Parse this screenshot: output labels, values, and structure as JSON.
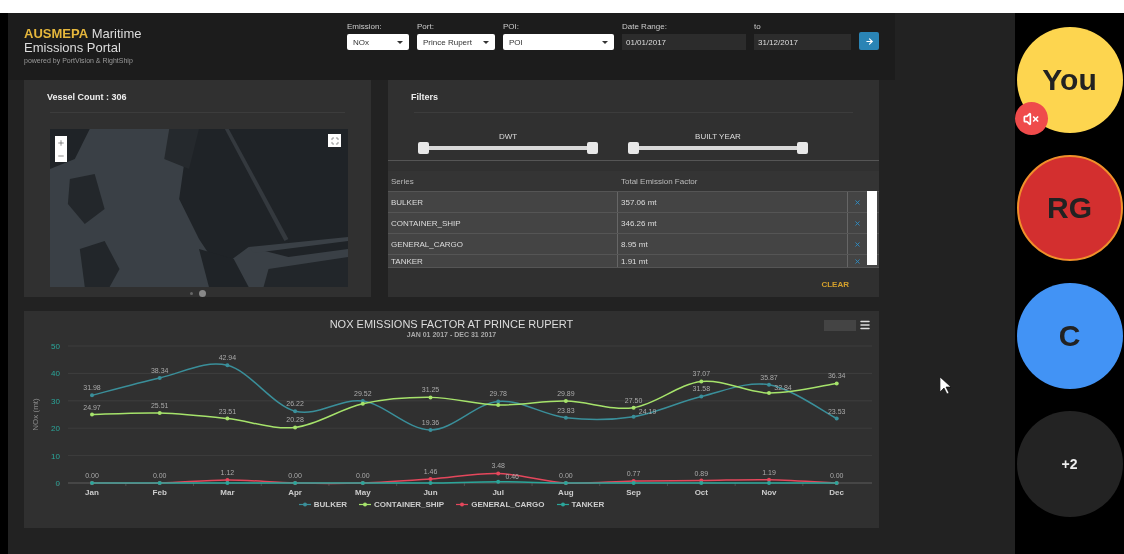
{
  "header": {
    "accent": "AUSMEPA",
    "title": "Maritime Emissions Portal",
    "tagline": "powered by PortVision & RightShip",
    "fields": [
      {
        "kind": "select",
        "label": "Emission:",
        "value": "NOx"
      },
      {
        "kind": "select",
        "label": "Port:",
        "value": "Prince Rupert"
      },
      {
        "kind": "select",
        "label": "POI:",
        "value": "POI"
      },
      {
        "kind": "date",
        "label": "Date Range:",
        "value": "01/01/2017"
      },
      {
        "kind": "date",
        "label": "to",
        "value": "31/12/2017"
      }
    ]
  },
  "map_panel": {
    "title": "Vessel Count : 306",
    "pager": [
      {
        "selected": false
      },
      {
        "selected": true
      }
    ]
  },
  "filters": {
    "title": "Filters",
    "sliders": [
      {
        "label": "DWT",
        "level": 1
      },
      {
        "label": "BUILT YEAR",
        "level": 1
      }
    ],
    "table": {
      "columns": [
        "Series",
        "Total Emission Factor"
      ],
      "rows": [
        {
          "series": "BULKER",
          "total": "357.06 mt"
        },
        {
          "series": "CONTAINER_SHIP",
          "total": "346.26 mt"
        },
        {
          "series": "GENERAL_CARGO",
          "total": "8.95 mt"
        },
        {
          "series": "TANKER",
          "total": "1.91 mt"
        }
      ]
    },
    "clear": "CLEAR"
  },
  "chart": {
    "subtitle": "JAN 01 2017 - DEC 31 2017",
    "chart_data": {
      "type": "line",
      "title": "NOX EMISSIONS FACTOR AT PRINCE RUPERT",
      "ylabel": "NOx (mt)",
      "categories": [
        "Jan",
        "Feb",
        "Mar",
        "Apr",
        "May",
        "Jun",
        "Jul",
        "Aug",
        "Sep",
        "Oct",
        "Nov",
        "Dec"
      ],
      "ylim": [
        0,
        50
      ],
      "yticks": [
        0,
        10,
        20,
        30,
        40,
        50
      ],
      "grid": true,
      "series": [
        {
          "name": "BULKER",
          "color": "#3a8f9a",
          "values": [
            31.98,
            38.34,
            42.94,
            26.22,
            29.9,
            19.36,
            29.78,
            23.83,
            24.19,
            31.58,
            35.87,
            23.53
          ]
        },
        {
          "name": "CONTAINER_SHIP",
          "color": "#a6e36b",
          "values": [
            24.97,
            25.51,
            23.51,
            20.28,
            28.9,
            31.25,
            28.5,
            29.89,
            27.5,
            37.07,
            32.84,
            36.34
          ]
        },
        {
          "name": "GENERAL_CARGO",
          "color": "#e5475c",
          "values": [
            0,
            0,
            1.12,
            0,
            0,
            1.46,
            3.48,
            0,
            0.77,
            0.89,
            1.19,
            0
          ]
        },
        {
          "name": "TANKER",
          "color": "#2aa69a",
          "values": [
            0,
            0,
            0,
            0,
            0,
            0,
            0.46,
            0,
            0,
            0,
            0,
            0
          ]
        }
      ],
      "value_labels": [
        [
          "31.98",
          "38.34",
          "42.94",
          "26.22",
          "29.52",
          "19.36",
          "29.78",
          "23.83",
          "24.19",
          "31.58",
          "35.87",
          "23.53"
        ],
        [
          "24.97",
          "25.51",
          "23.51",
          "20.28",
          null,
          "31.25",
          null,
          "29.89",
          "27.50",
          "37.07",
          "32.84",
          "36.34"
        ],
        [
          "0.00",
          "0.00",
          "1.12",
          "0.00",
          "0.00",
          "1.46",
          "3.48",
          "0.00",
          "0.77",
          "0.89",
          "1.19",
          "0.00"
        ],
        [
          null,
          null,
          null,
          null,
          null,
          null,
          "0.46",
          null,
          null,
          null,
          null,
          null
        ]
      ]
    }
  },
  "participants": [
    {
      "kind": "avatar",
      "label": "You",
      "color": "#fdd54f",
      "muted": true,
      "speaking": false
    },
    {
      "kind": "avatar",
      "label": "RG",
      "color": "#d32f2f",
      "muted": false,
      "speaking": true
    },
    {
      "kind": "avatar",
      "label": "C",
      "color": "#4293f5",
      "muted": false,
      "speaking": false
    },
    {
      "kind": "overflow",
      "label": "+2"
    }
  ]
}
